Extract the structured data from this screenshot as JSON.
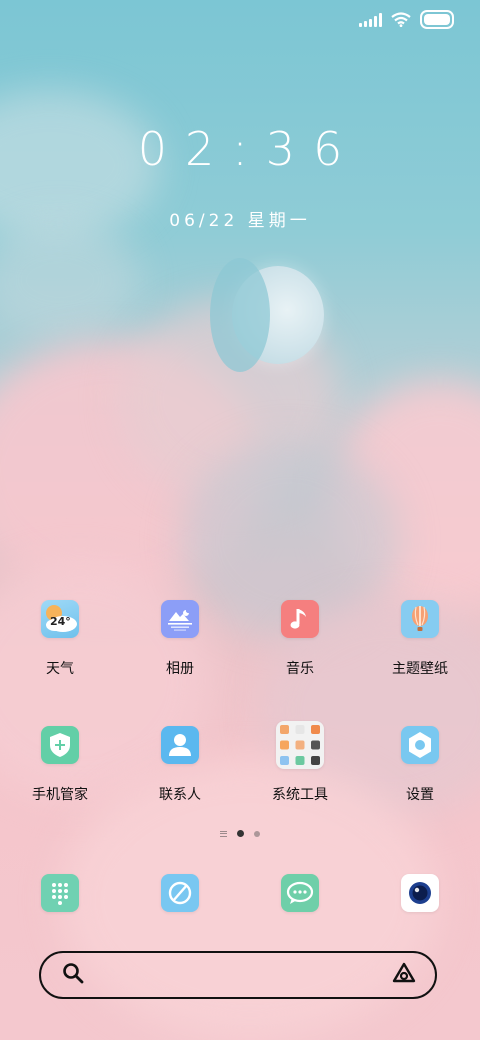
{
  "status_bar": {
    "signal_icon": "signal-icon",
    "wifi_icon": "wifi-icon",
    "battery_icon": "battery-icon"
  },
  "clock": {
    "time": "02:36",
    "date": "06/22 星期一"
  },
  "apps": [
    [
      {
        "label": "天气",
        "icon": "weather-icon",
        "badge": "24°",
        "color": "#7fc9ef"
      },
      {
        "label": "相册",
        "icon": "gallery-icon",
        "color": "#8c9ef7"
      },
      {
        "label": "音乐",
        "icon": "music-icon",
        "color": "#f57f7f"
      },
      {
        "label": "主题壁纸",
        "icon": "theme-balloon-icon",
        "color": "#86ccf1"
      }
    ],
    [
      {
        "label": "手机管家",
        "icon": "security-shield-icon",
        "color": "#62cfa7"
      },
      {
        "label": "联系人",
        "icon": "contacts-icon",
        "color": "#5bb8ef"
      },
      {
        "label": "系统工具",
        "icon": "system-tools-folder-icon",
        "color": "#f4f4f4"
      },
      {
        "label": "设置",
        "icon": "settings-hexagon-icon",
        "color": "#79c8f0"
      }
    ]
  ],
  "dock": [
    {
      "icon": "dialer-icon",
      "color": "#70d1b2"
    },
    {
      "icon": "browser-icon",
      "color": "#79c7f1"
    },
    {
      "icon": "messages-icon",
      "color": "#6fcfa9"
    },
    {
      "icon": "camera-icon",
      "color": "#ffffff"
    }
  ],
  "search": {
    "search_icon": "search-icon",
    "assistant_icon": "assistant-icon"
  }
}
